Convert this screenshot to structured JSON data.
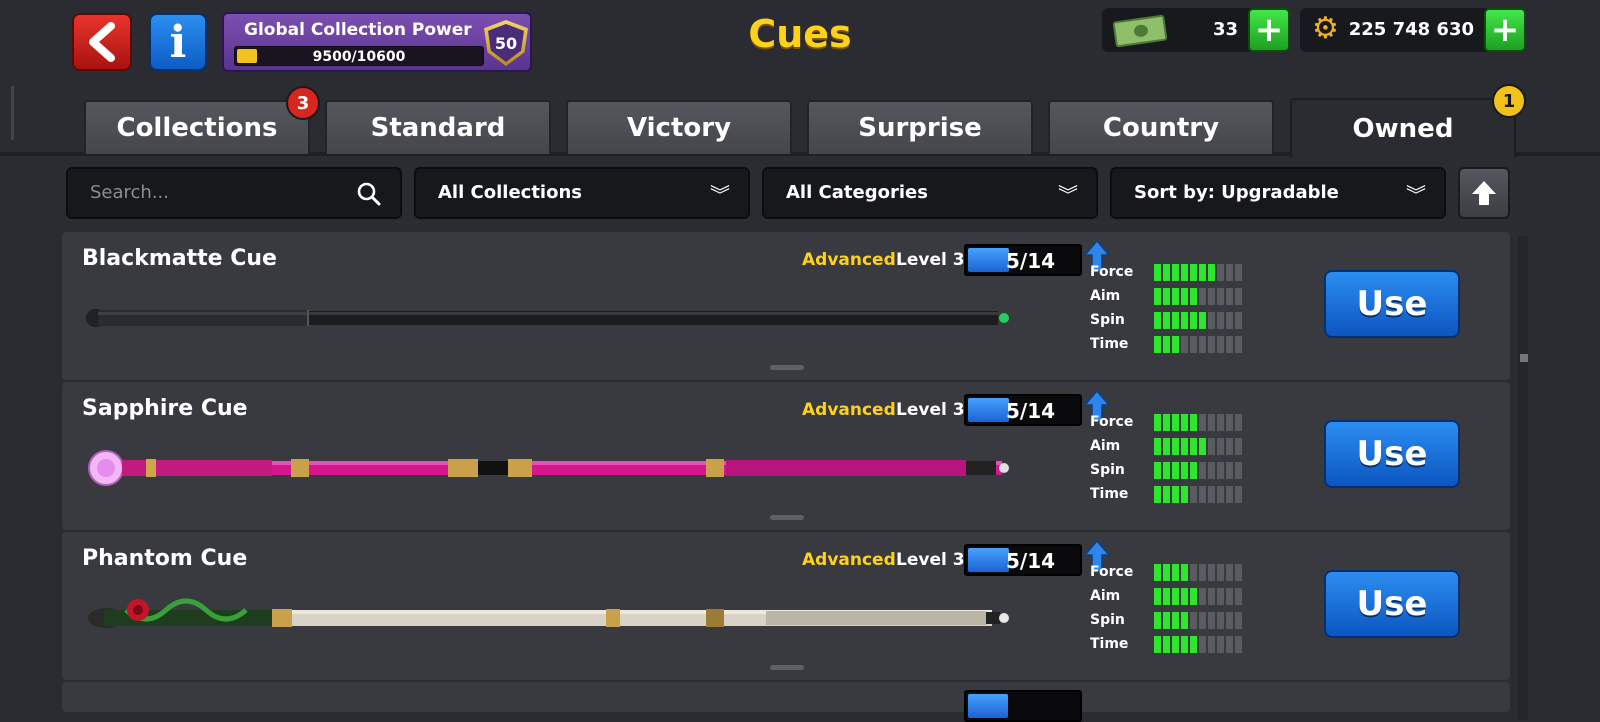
{
  "header": {
    "title": "Cues",
    "power": {
      "title": "Global Collection Power",
      "progress_text": "9500/10600",
      "progress_fraction": 0.896,
      "level": "50"
    },
    "cash": {
      "amount": "33",
      "icon": "cash-icon"
    },
    "coins": {
      "amount": "225 748 630",
      "icon": "gear-coin-icon"
    }
  },
  "tabs": [
    {
      "label": "Collections",
      "badge": "3",
      "badge_color": "#d8261f",
      "active": false
    },
    {
      "label": "Standard",
      "active": false
    },
    {
      "label": "Victory",
      "active": false
    },
    {
      "label": "Surprise",
      "active": false
    },
    {
      "label": "Country",
      "active": false
    },
    {
      "label": "Owned",
      "badge": "1",
      "badge_color": "#f2c21a",
      "active": true
    }
  ],
  "filters": {
    "search_placeholder": "Search...",
    "collections": "All Collections",
    "categories": "All Categories",
    "sort": "Sort by: Upgradable"
  },
  "cues": [
    {
      "name": "Blackmatte Cue",
      "tier": "Advanced",
      "level": "Level 3",
      "progress": "5/14",
      "progress_fraction": 0.357,
      "stats": {
        "Force": 7,
        "Aim": 5,
        "Spin": 6,
        "Time": 3
      },
      "use_label": "Use",
      "style": "black"
    },
    {
      "name": "Sapphire Cue",
      "tier": "Advanced",
      "level": "Level 3",
      "progress": "5/14",
      "progress_fraction": 0.357,
      "stats": {
        "Force": 5,
        "Aim": 6,
        "Spin": 5,
        "Time": 4
      },
      "use_label": "Use",
      "style": "pink"
    },
    {
      "name": "Phantom Cue",
      "tier": "Advanced",
      "level": "Level 3",
      "progress": "5/14",
      "progress_fraction": 0.357,
      "stats": {
        "Force": 4,
        "Aim": 5,
        "Spin": 4,
        "Time": 5
      },
      "use_label": "Use",
      "style": "silver"
    }
  ],
  "stat_max": 10,
  "colors": {
    "accent_gold": "#ffd21a",
    "stat_on": "#2ee62e",
    "use_blue": "#1c6fdc"
  }
}
